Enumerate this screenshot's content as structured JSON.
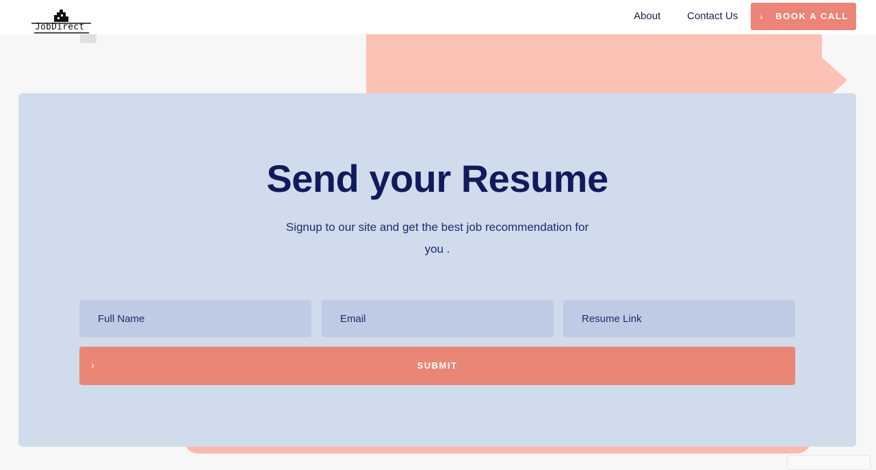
{
  "header": {
    "logo_text": "JobDirect",
    "nav": [
      {
        "label": "About"
      },
      {
        "label": "Contact Us"
      }
    ],
    "cta_label": "BOOK A CALL",
    "cta_icon": "chevron-right-icon"
  },
  "hero": {
    "title": "Send your Resume",
    "subtitle": "Signup to our site and get the best job recommendation for you ."
  },
  "form": {
    "fields": [
      {
        "placeholder": "Full Name",
        "value": ""
      },
      {
        "placeholder": "Email",
        "value": ""
      },
      {
        "placeholder": "Resume Link",
        "value": ""
      }
    ],
    "submit_label": "SUBMIT",
    "submit_icon": "chevron-right-icon"
  },
  "colors": {
    "accent": "#ec8577",
    "decor_salmon": "#fcc1b5",
    "card_bg": "#d0dceb",
    "field_bg": "#bfcbe5",
    "heading": "#101b5e"
  }
}
